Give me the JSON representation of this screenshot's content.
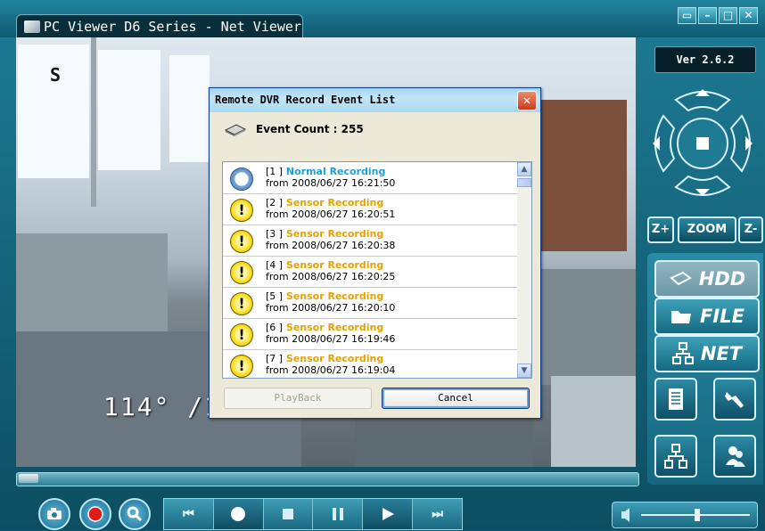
{
  "window": {
    "title": "PC Viewer D6 Series - Net Viewer",
    "controls": [
      "restore-icon",
      "minimize-icon",
      "maximize-icon",
      "close-icon"
    ]
  },
  "video": {
    "osd_channel": "S",
    "osd_timestamp": "114° /1"
  },
  "right_panel": {
    "version": "Ver 2.6.2",
    "zoom_label": "ZOOM",
    "zoom_in_label": "Z+",
    "zoom_out_label": "Z-",
    "hdd_label": "HDD",
    "file_label": "FILE",
    "net_label": "NET"
  },
  "dialog": {
    "title": "Remote DVR Record Event List",
    "close_glyph": "✕",
    "event_count_text": "Event Count : 255",
    "events": [
      {
        "index": "[1 ]",
        "name": "Normal Recording",
        "kind": "normal",
        "time": "from 2008/06/27 16:21:50"
      },
      {
        "index": "[2 ]",
        "name": "Sensor Recording",
        "kind": "sensor",
        "time": "from 2008/06/27 16:20:51"
      },
      {
        "index": "[3 ]",
        "name": "Sensor Recording",
        "kind": "sensor",
        "time": "from 2008/06/27 16:20:38"
      },
      {
        "index": "[4 ]",
        "name": "Sensor Recording",
        "kind": "sensor",
        "time": "from 2008/06/27 16:20:25"
      },
      {
        "index": "[5 ]",
        "name": "Sensor Recording",
        "kind": "sensor",
        "time": "from 2008/06/27 16:20:10"
      },
      {
        "index": "[6 ]",
        "name": "Sensor Recording",
        "kind": "sensor",
        "time": "from 2008/06/27 16:19:46"
      },
      {
        "index": "[7 ]",
        "name": "Sensor Recording",
        "kind": "sensor",
        "time": "from 2008/06/27 16:19:04"
      }
    ],
    "playback_label": "PlayBack",
    "cancel_label": "Cancel"
  },
  "colors": {
    "normal_event": "#1e9fd8",
    "sensor_event": "#e6a100",
    "panel_teal": "#1d7c95"
  }
}
